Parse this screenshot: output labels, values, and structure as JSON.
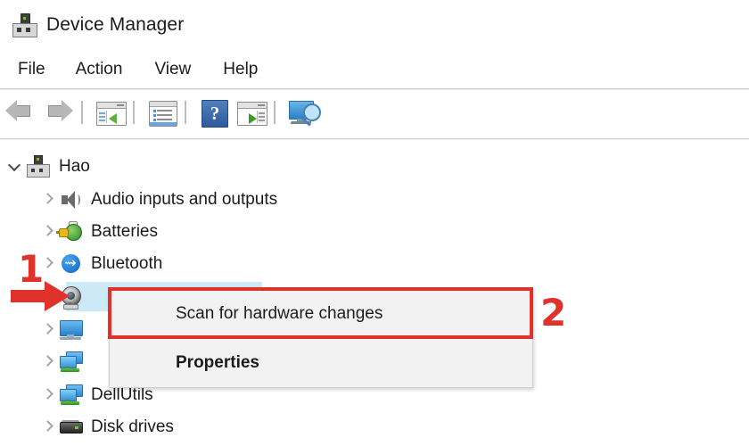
{
  "window": {
    "title": "Device Manager",
    "icon": "device-manager-icon"
  },
  "menubar": {
    "items": [
      {
        "label": "File"
      },
      {
        "label": "Action"
      },
      {
        "label": "View"
      },
      {
        "label": "Help"
      }
    ]
  },
  "toolbar": {
    "buttons": [
      {
        "icon": "back-arrow-icon",
        "tooltip": "Back"
      },
      {
        "icon": "forward-arrow-icon",
        "tooltip": "Forward"
      },
      {
        "icon": "show-hide-console-tree-icon",
        "tooltip": "Show/Hide Console Tree"
      },
      {
        "icon": "properties-icon",
        "tooltip": "Properties"
      },
      {
        "icon": "help-icon",
        "tooltip": "Help"
      },
      {
        "icon": "show-hide-action-pane-icon",
        "tooltip": "Show/Hide Action Pane"
      },
      {
        "icon": "scan-for-hardware-changes-icon",
        "tooltip": "Scan for hardware changes"
      }
    ]
  },
  "tree": {
    "rows": [
      {
        "label": "Hao",
        "icon": "computer-icon",
        "chevron": "down",
        "indent": 0,
        "selected": false
      },
      {
        "label": "Audio inputs and outputs",
        "icon": "speaker-icon",
        "chevron": "right",
        "indent": 1,
        "selected": false
      },
      {
        "label": "Batteries",
        "icon": "battery-icon",
        "chevron": "right",
        "indent": 1,
        "selected": false
      },
      {
        "label": "Bluetooth",
        "icon": "bluetooth-icon",
        "chevron": "right",
        "indent": 1,
        "selected": false
      },
      {
        "label": "",
        "icon": "camera-icon",
        "chevron": "none",
        "indent": 1,
        "selected": true
      },
      {
        "label": "",
        "icon": "monitor-icon",
        "chevron": "right",
        "indent": 1,
        "selected": false
      },
      {
        "label": "",
        "icon": "network-icon",
        "chevron": "right",
        "indent": 1,
        "selected": false
      },
      {
        "label": "DellUtils",
        "icon": "network-icon",
        "chevron": "right",
        "indent": 1,
        "selected": false
      },
      {
        "label": "Disk drives",
        "icon": "disk-drive-icon",
        "chevron": "right",
        "indent": 1,
        "selected": false
      }
    ]
  },
  "context_menu": {
    "items": [
      {
        "label": "Scan for hardware changes",
        "bold": false,
        "highlighted": true
      },
      {
        "label": "Properties",
        "bold": true,
        "highlighted": false
      }
    ]
  },
  "annotations": {
    "step_one": "1",
    "step_two": "2",
    "arrow": "red-arrow-icon",
    "color": "#e0312a"
  },
  "colors": {
    "accent_red": "#e0312a",
    "selection_blue": "#cde8f7",
    "menu_background": "#f2f2f2",
    "text": "#1b1b1b"
  }
}
